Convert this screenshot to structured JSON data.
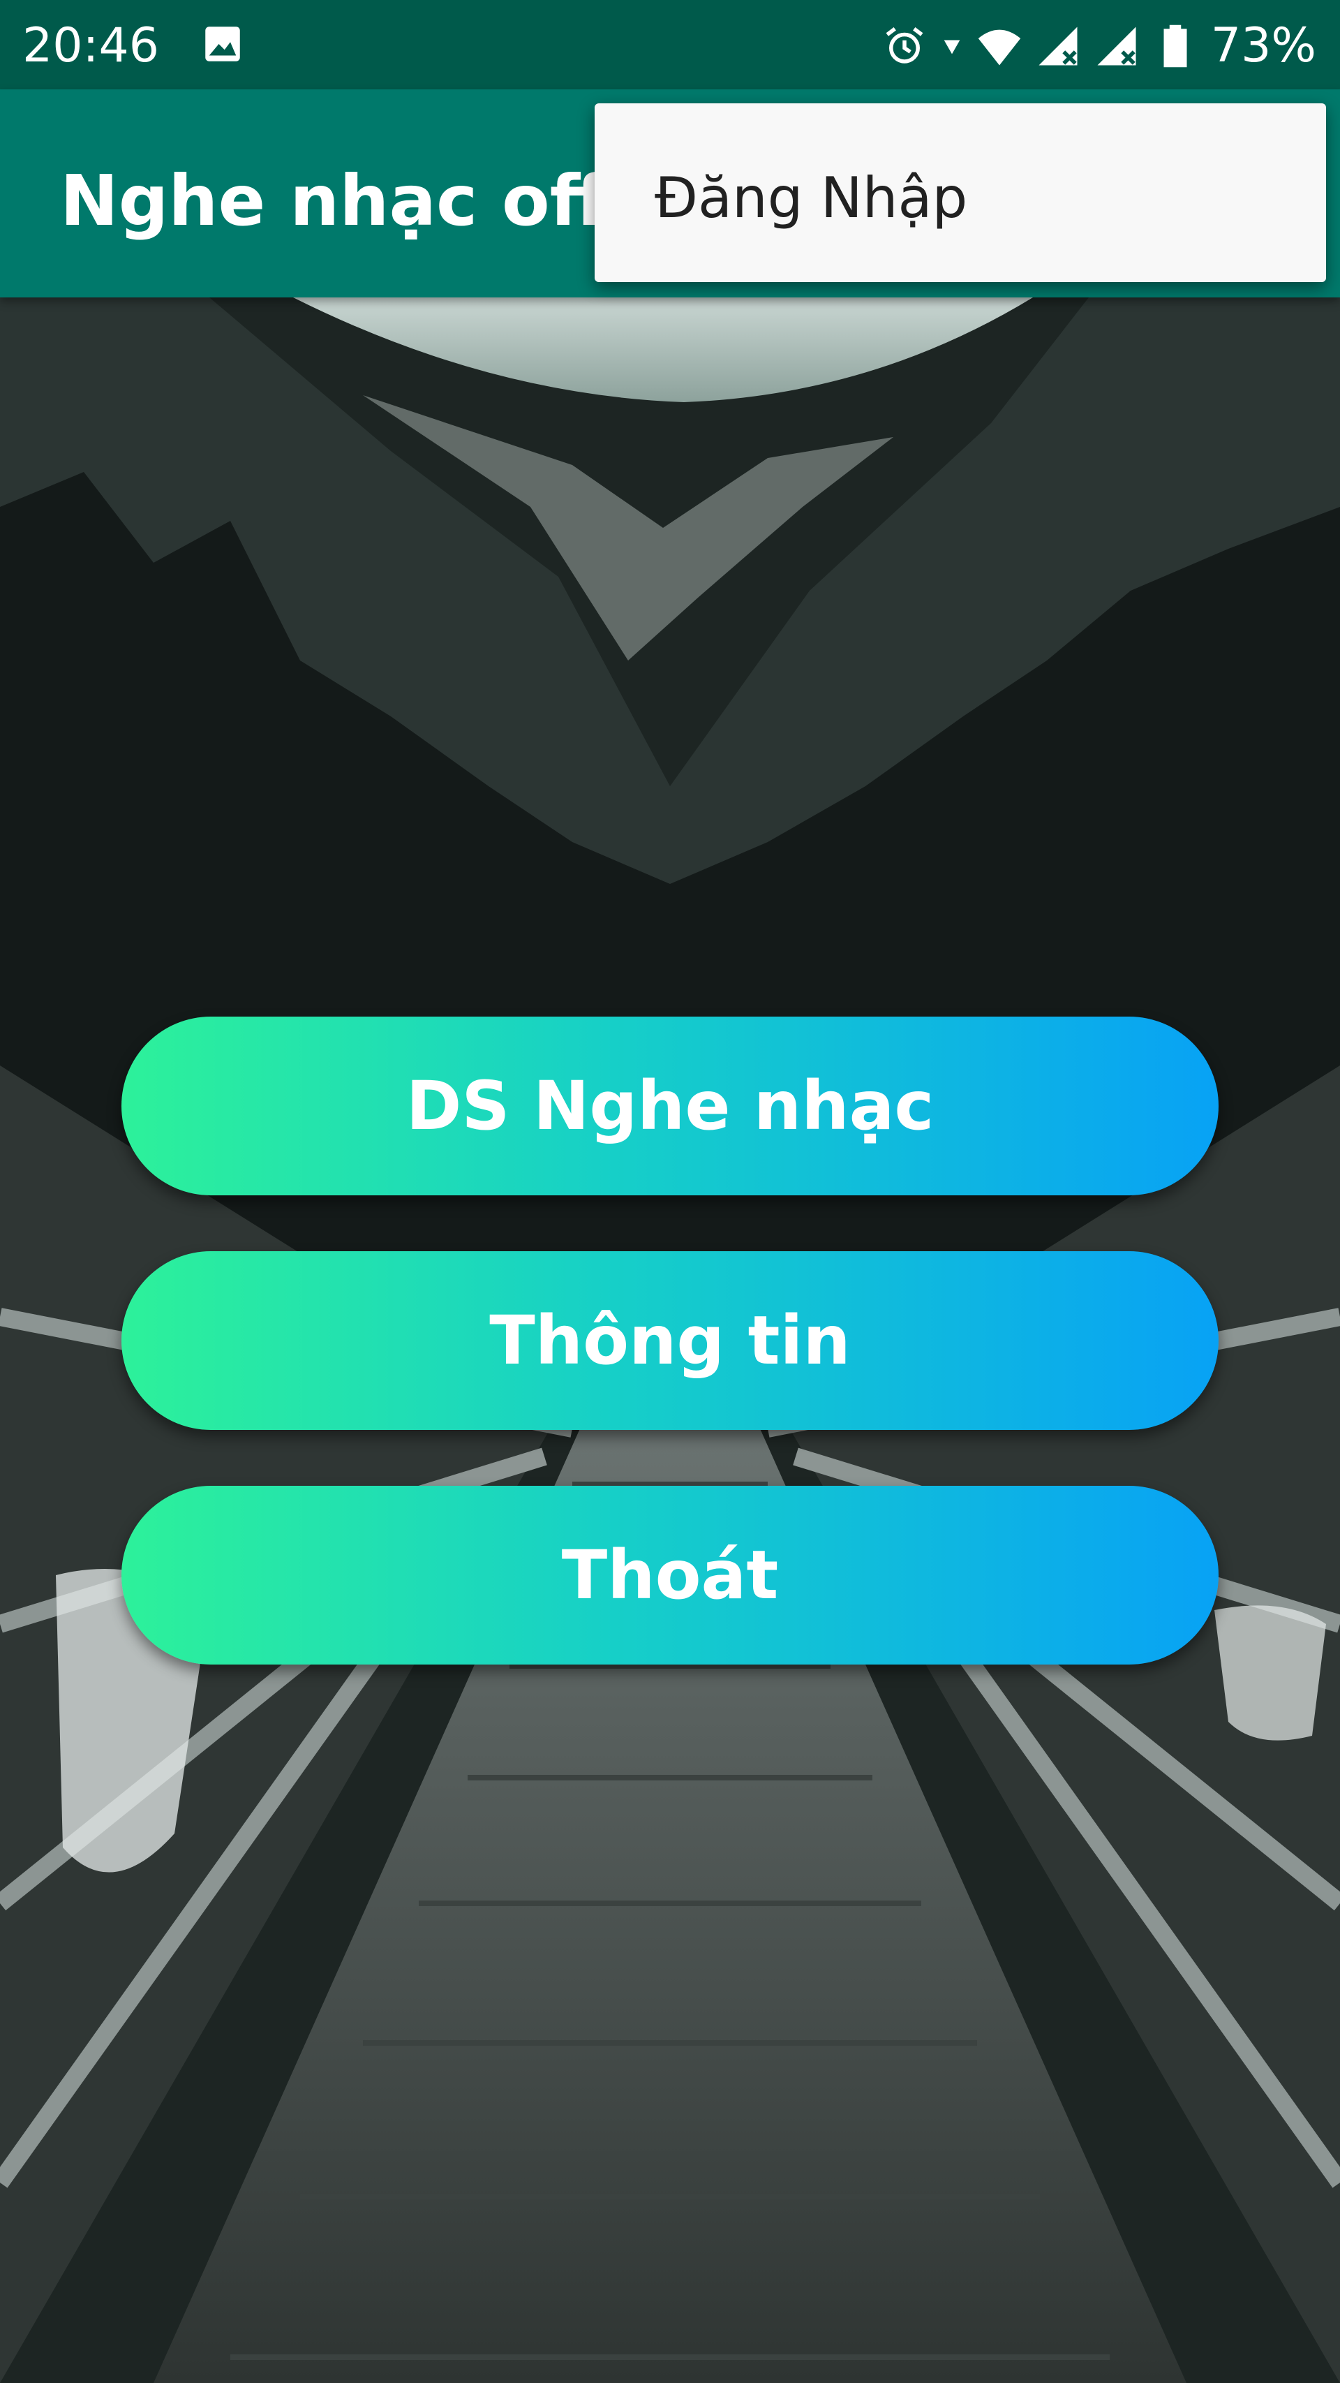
{
  "status_bar": {
    "time": "20:46",
    "battery": "73%",
    "icons": [
      "image-icon",
      "alarm-icon",
      "data-arrow-icon",
      "wifi-icon",
      "signal-icon",
      "signal-icon",
      "battery-icon"
    ]
  },
  "app_bar": {
    "title": "Nghe nhạc offline"
  },
  "menu": {
    "items": [
      {
        "label": "Đăng Nhập"
      }
    ]
  },
  "main": {
    "buttons": [
      {
        "label": "DS Nghe nhạc"
      },
      {
        "label": "Thông tin"
      },
      {
        "label": "Thoát"
      }
    ]
  },
  "colors": {
    "status_bar": "#005a4b",
    "app_bar": "#00796b",
    "button_gradient_start": "#2df19a",
    "button_gradient_end": "#08a2f5",
    "menu_background": "#f8f8f8"
  }
}
